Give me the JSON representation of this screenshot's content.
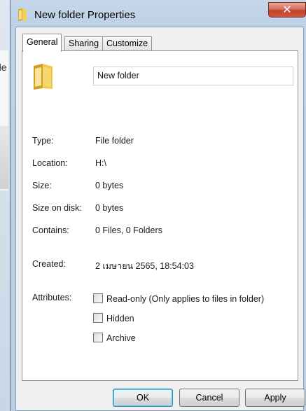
{
  "window": {
    "title": "New folder Properties",
    "close_label": "✕"
  },
  "background_window": {
    "partial_text": "de"
  },
  "tabs": [
    {
      "label": "General",
      "active": true
    },
    {
      "label": "Sharing",
      "active": false
    },
    {
      "label": "Customize",
      "active": false
    }
  ],
  "general": {
    "folder_icon": "folder-icon",
    "name_value": "New folder",
    "rows": [
      {
        "label": "Type:",
        "value": "File folder"
      },
      {
        "label": "Location:",
        "value": "H:\\"
      },
      {
        "label": "Size:",
        "value": "0 bytes"
      },
      {
        "label": "Size on disk:",
        "value": "0 bytes"
      },
      {
        "label": "Contains:",
        "value": "0 Files, 0 Folders"
      }
    ],
    "created": {
      "label": "Created:",
      "value": "2 เมษายน 2565, 18:54:03"
    },
    "attributes": {
      "label": "Attributes:",
      "items": [
        {
          "label": "Read-only (Only applies to files in folder)",
          "checked": false
        },
        {
          "label": "Hidden",
          "checked": false
        },
        {
          "label": "Archive",
          "checked": false
        }
      ]
    }
  },
  "buttons": {
    "ok": "OK",
    "cancel": "Cancel",
    "apply": "Apply"
  },
  "colors": {
    "frame": "#bcd0e6",
    "close_button": "#c2412b",
    "default_button_border": "#3c7fb1"
  }
}
